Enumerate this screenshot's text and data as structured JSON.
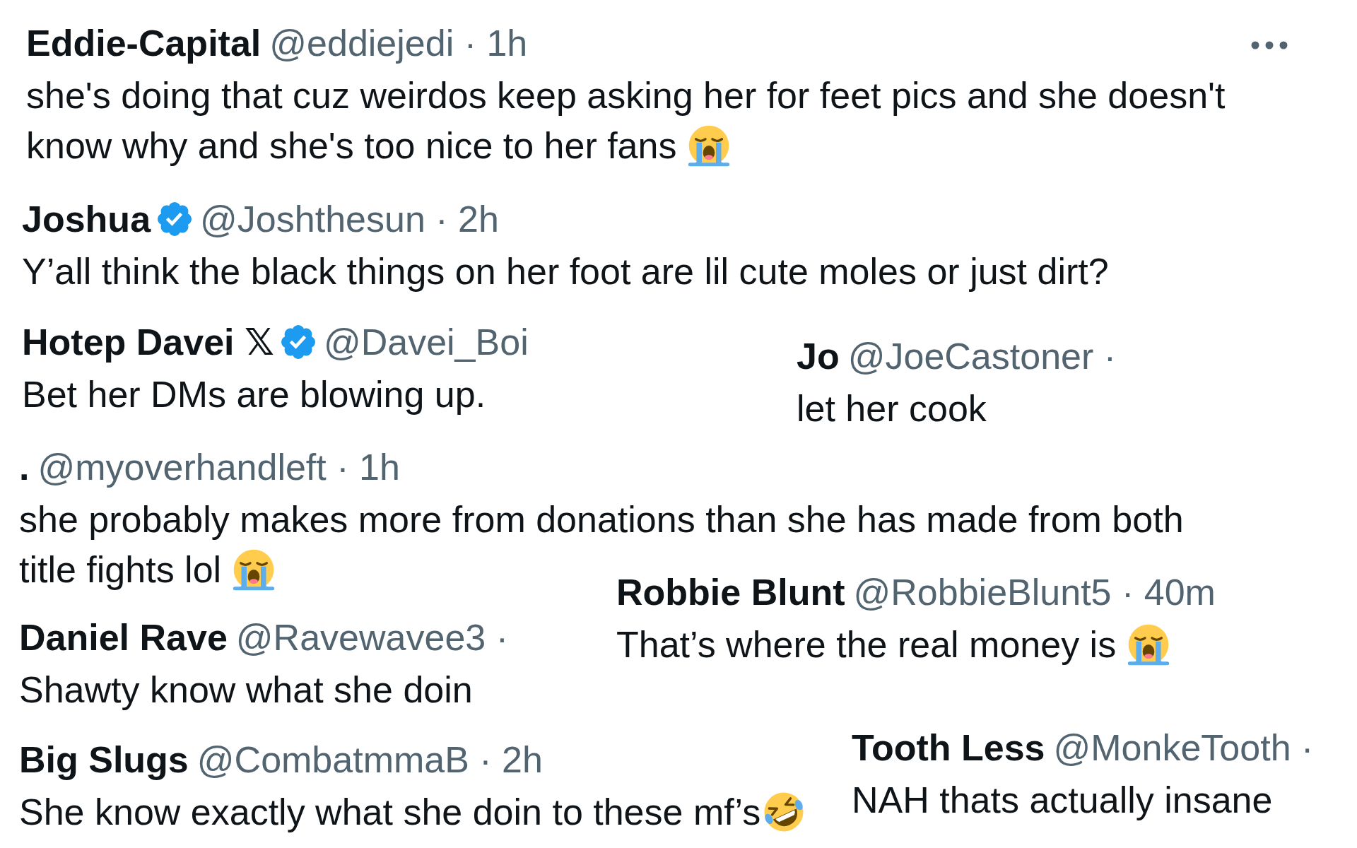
{
  "tweets": [
    {
      "name": "Eddie-Capital",
      "verified": false,
      "meta": "@eddiejedi · 1h",
      "more_menu": true,
      "text_lines": [
        "she's doing that cuz weirdos keep asking her for feet pics and she doesn't",
        "know why and she's too nice to her fans"
      ],
      "emoji": {
        "kind": "crying"
      }
    },
    {
      "name": "Joshua",
      "verified": true,
      "meta": "@Joshthesun · 2h",
      "more_menu": false,
      "text_lines": [
        "Y’all think the black things on her foot are lil cute moles or just dirt?"
      ]
    },
    {
      "name": "Hotep Davei 𝕏",
      "verified": true,
      "meta": "@Davei_Boi",
      "more_menu": false,
      "text_lines": [
        "Bet her DMs are blowing up."
      ]
    },
    {
      "name": "Jo",
      "verified": false,
      "meta": "@JoeCastoner ·",
      "more_menu": false,
      "text_lines": [
        "let her cook"
      ]
    },
    {
      "name": ".",
      "verified": false,
      "meta": "@myoverhandleft · 1h",
      "more_menu": false,
      "text_lines": [
        "she probably makes more from donations than she has made from both",
        "title fights lol"
      ],
      "emoji": {
        "kind": "crying"
      }
    },
    {
      "name": "Robbie Blunt",
      "verified": false,
      "meta": "@RobbieBlunt5 · 40m",
      "more_menu": false,
      "text_lines": [
        "That’s where the real money is"
      ],
      "emoji": {
        "kind": "crying"
      }
    },
    {
      "name": "Daniel Rave",
      "verified": false,
      "meta": "@Ravewavee3 ·",
      "more_menu": false,
      "text_lines": [
        "Shawty know what she doin"
      ]
    },
    {
      "name": "Big Slugs",
      "verified": false,
      "meta": "@CombatmmaB · 2h",
      "more_menu": false,
      "text_lines": [
        "She know exactly what she doin to these mf’s"
      ],
      "emoji": {
        "kind": "laughing"
      }
    },
    {
      "name": "Tooth Less",
      "verified": false,
      "meta": "@MonkeTooth ·",
      "more_menu": false,
      "text_lines": [
        "NAH thats actually insane"
      ]
    }
  ]
}
